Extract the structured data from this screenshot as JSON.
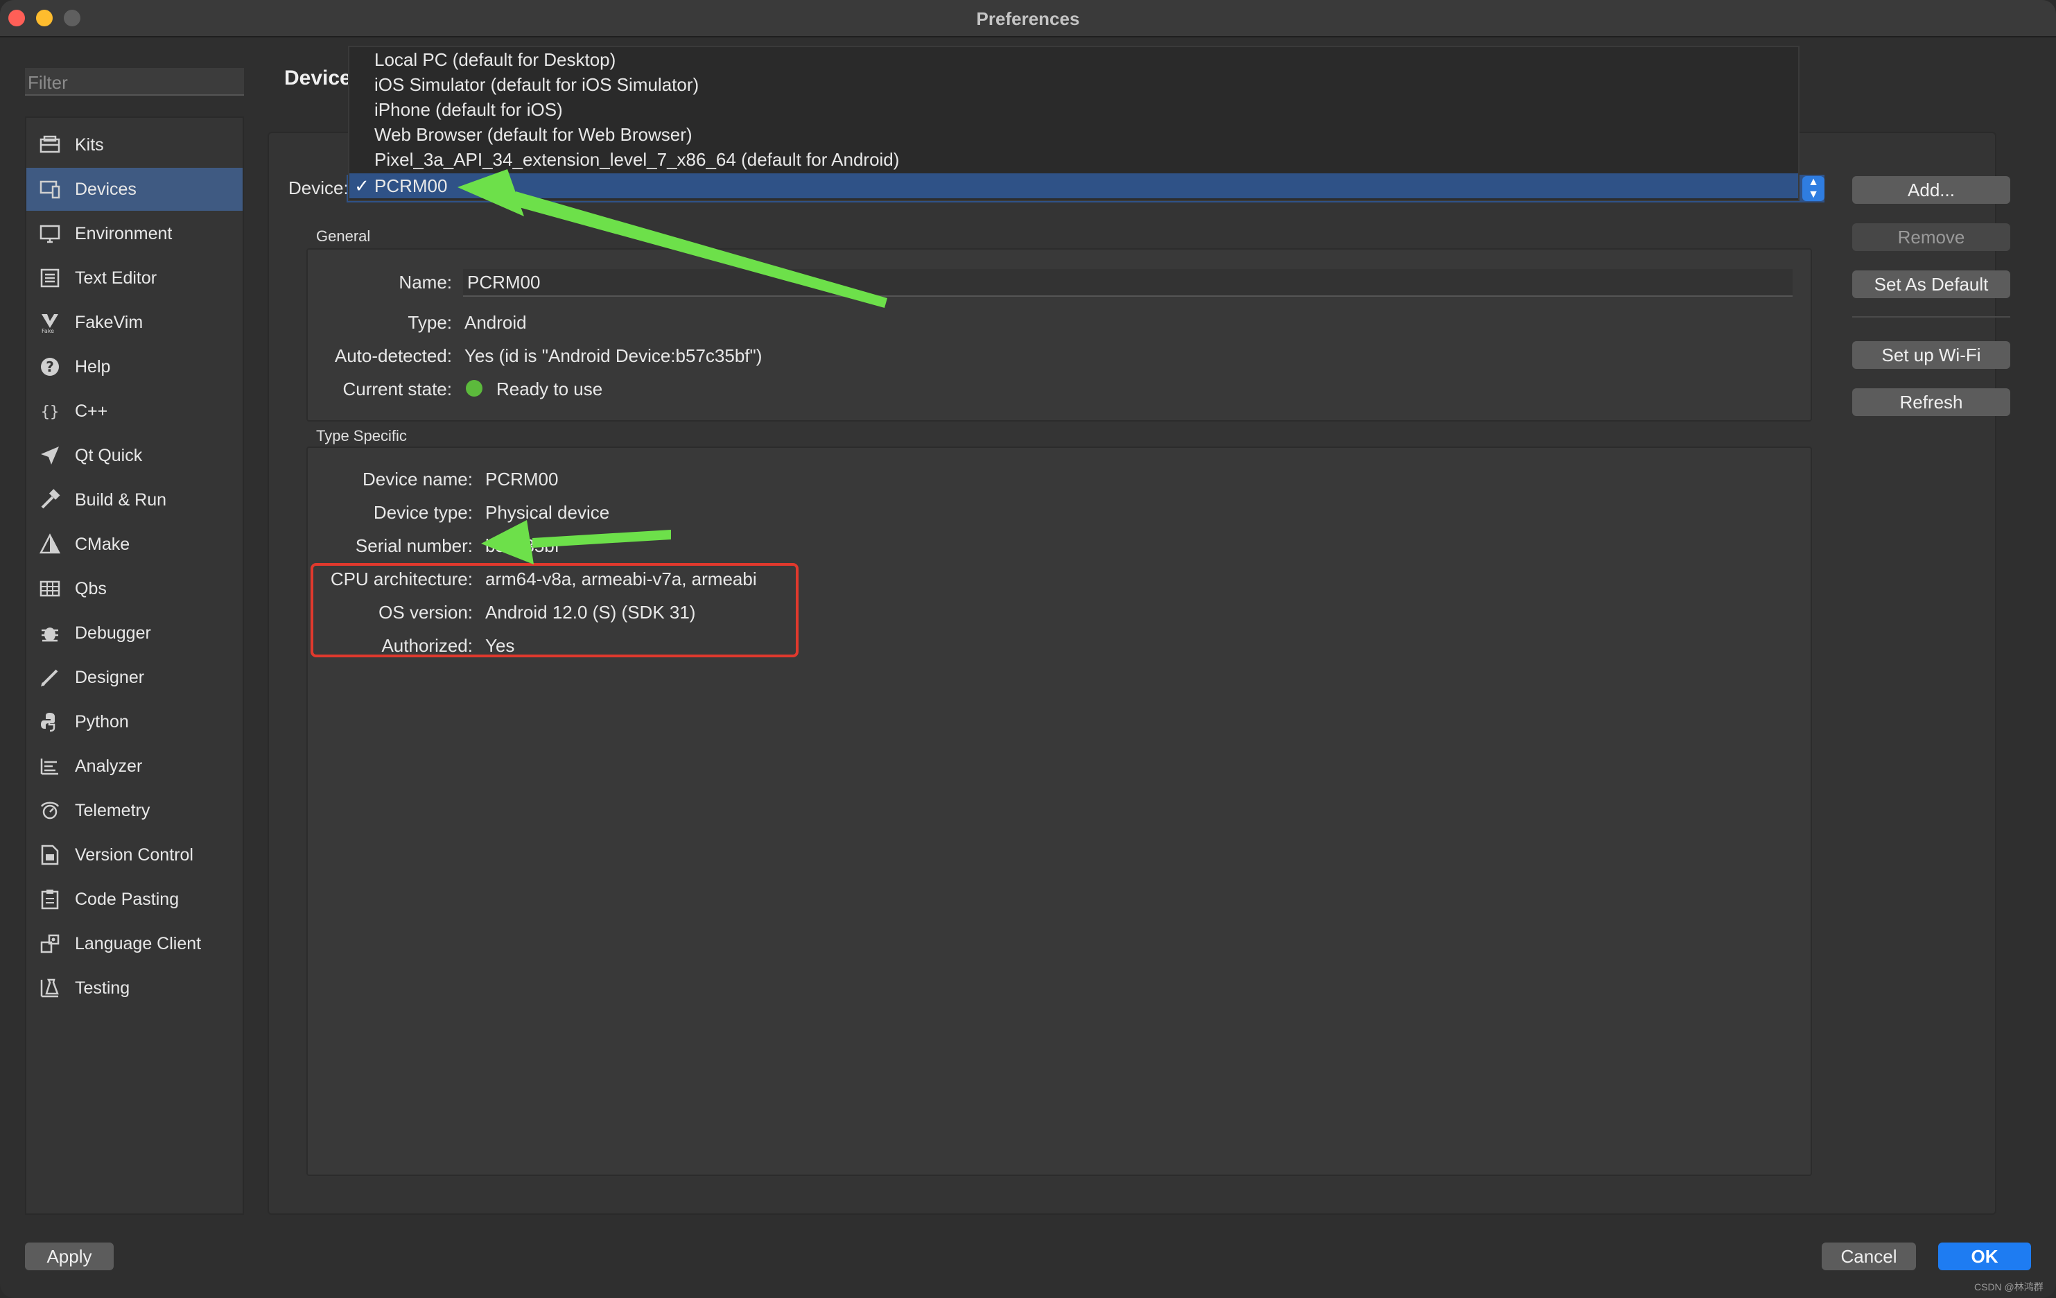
{
  "window": {
    "title": "Preferences"
  },
  "sidebar": {
    "filter_placeholder": "Filter",
    "items": [
      {
        "label": "Kits",
        "icon": "kits-icon"
      },
      {
        "label": "Devices",
        "icon": "devices-icon",
        "selected": true
      },
      {
        "label": "Environment",
        "icon": "environment-icon"
      },
      {
        "label": "Text Editor",
        "icon": "text-editor-icon"
      },
      {
        "label": "FakeVim",
        "icon": "fakevim-icon"
      },
      {
        "label": "Help",
        "icon": "help-icon"
      },
      {
        "label": "C++",
        "icon": "cpp-icon"
      },
      {
        "label": "Qt Quick",
        "icon": "qt-quick-icon"
      },
      {
        "label": "Build & Run",
        "icon": "build-run-icon"
      },
      {
        "label": "CMake",
        "icon": "cmake-icon"
      },
      {
        "label": "Qbs",
        "icon": "qbs-icon"
      },
      {
        "label": "Debugger",
        "icon": "debugger-icon"
      },
      {
        "label": "Designer",
        "icon": "designer-icon"
      },
      {
        "label": "Python",
        "icon": "python-icon"
      },
      {
        "label": "Analyzer",
        "icon": "analyzer-icon"
      },
      {
        "label": "Telemetry",
        "icon": "telemetry-icon"
      },
      {
        "label": "Version Control",
        "icon": "version-control-icon"
      },
      {
        "label": "Code Pasting",
        "icon": "code-pasting-icon"
      },
      {
        "label": "Language Client",
        "icon": "language-client-icon"
      },
      {
        "label": "Testing",
        "icon": "testing-icon"
      }
    ]
  },
  "main": {
    "section_title": "Device",
    "device_label": "Device:",
    "dropdown": {
      "options": [
        "Local PC (default for Desktop)",
        "iOS Simulator (default for iOS Simulator)",
        "iPhone (default for iOS)",
        "Web Browser (default for Web Browser)",
        "Pixel_3a_API_34_extension_level_7_x86_64 (default for Android)"
      ],
      "selected": "PCRM00",
      "check_mark": "✓"
    },
    "buttons": {
      "add": "Add...",
      "remove": "Remove",
      "set_default": "Set As Default",
      "setup_wifi": "Set up Wi-Fi",
      "refresh": "Refresh"
    },
    "general": {
      "title": "General",
      "name_label": "Name:",
      "name_value": "PCRM00",
      "type_label": "Type:",
      "type_value": "Android",
      "autodetected_label": "Auto-detected:",
      "autodetected_value": "Yes (id is \"Android Device:b57c35bf\")",
      "state_label": "Current state:",
      "state_value": "Ready to use",
      "state_color": "#5cba3c"
    },
    "type_specific": {
      "title": "Type Specific",
      "device_name_label": "Device name:",
      "device_name_value": "PCRM00",
      "device_type_label": "Device type:",
      "device_type_value": "Physical device",
      "serial_label": "Serial number:",
      "serial_value": "b57c35bf",
      "cpu_label": "CPU architecture:",
      "cpu_value": "arm64-v8a, armeabi-v7a, armeabi",
      "os_label": "OS version:",
      "os_value": "Android 12.0 (S) (SDK 31)",
      "authorized_label": "Authorized:",
      "authorized_value": "Yes"
    }
  },
  "footer": {
    "apply": "Apply",
    "cancel": "Cancel",
    "ok": "OK",
    "watermark": "CSDN @林鸿群"
  },
  "colors": {
    "accent": "#1e7cf2",
    "selection": "#2f5287",
    "annotation_arrow": "#6de04a",
    "annotation_box": "#e0392d"
  }
}
